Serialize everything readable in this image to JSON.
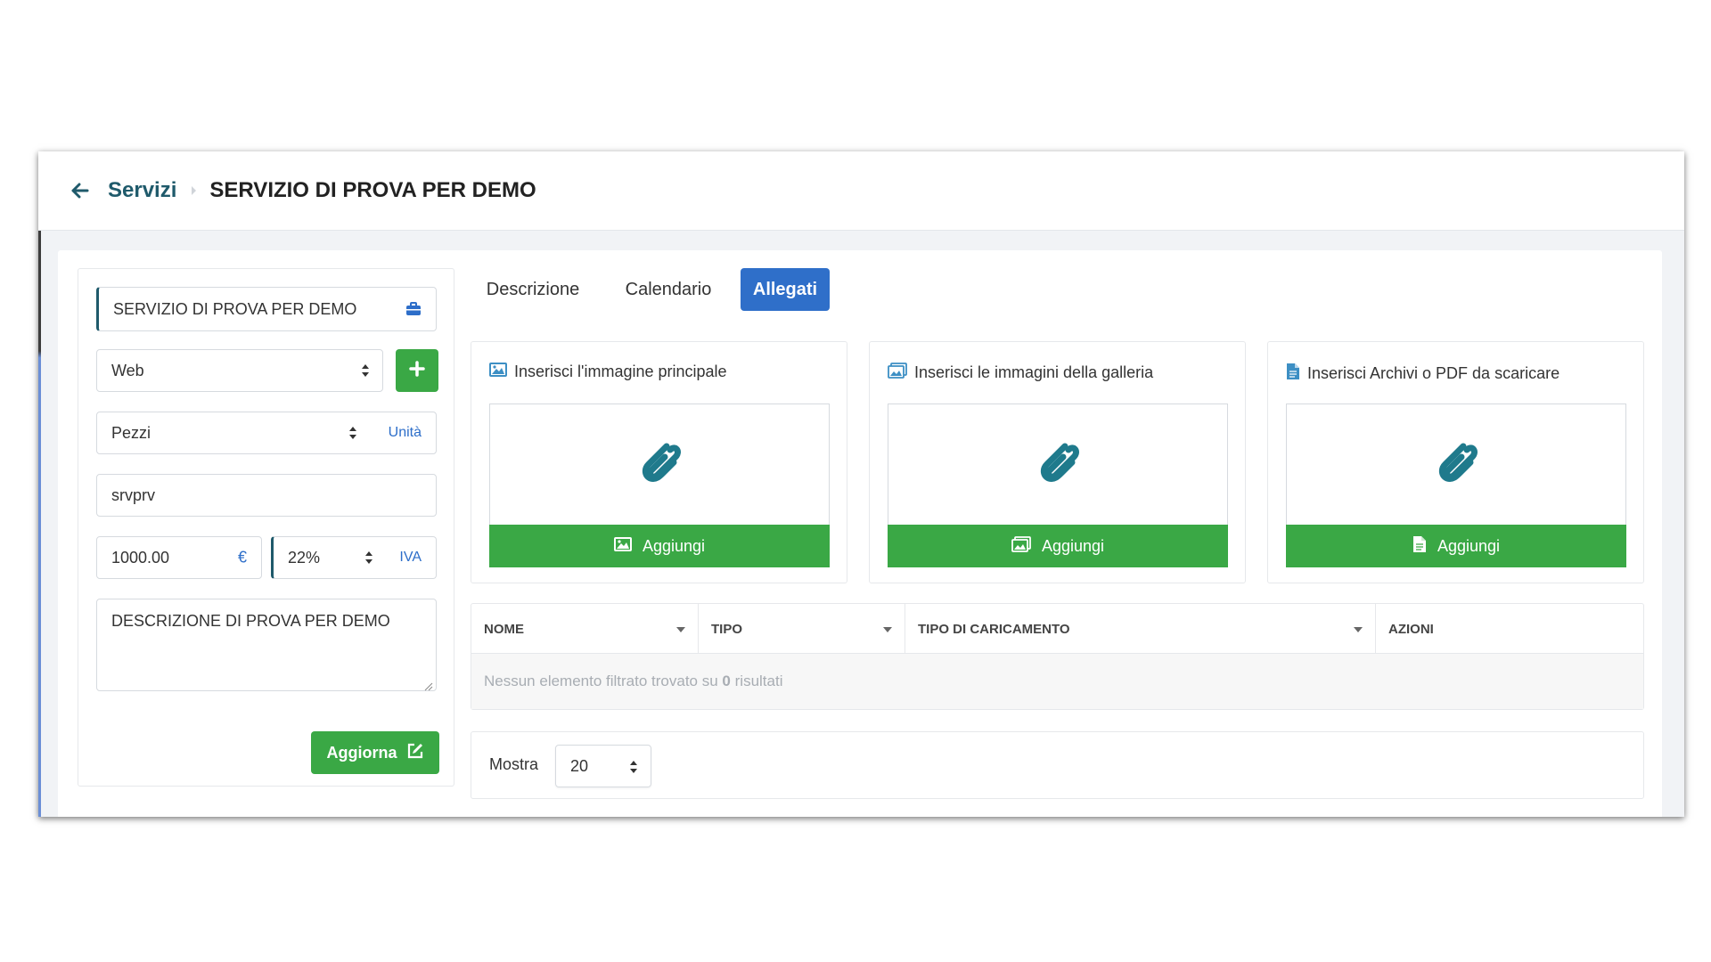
{
  "breadcrumb": {
    "parent": "Servizi",
    "current": "SERVIZIO DI PROVA PER DEMO"
  },
  "form": {
    "name": "SERVIZIO DI PROVA PER DEMO",
    "category": "Web",
    "unit": "Pezzi",
    "unit_suffix": "Unità",
    "code": "srvprv",
    "price": "1000.00",
    "price_suffix": "€",
    "vat": "22%",
    "vat_suffix": "IVA",
    "description": "DESCRIZIONE DI PROVA PER DEMO",
    "update_label": "Aggiorna"
  },
  "tabs": [
    {
      "label": "Descrizione",
      "active": false
    },
    {
      "label": "Calendario",
      "active": false
    },
    {
      "label": "Allegati",
      "active": true
    }
  ],
  "cards": [
    {
      "title": "Inserisci l'immagine principale",
      "icon": "image-icon",
      "button": "Aggiungi"
    },
    {
      "title": "Inserisci le immagini della galleria",
      "icon": "images-icon",
      "button": "Aggiungi"
    },
    {
      "title": "Inserisci Archivi o PDF da scaricare",
      "icon": "file-icon",
      "button": "Aggiungi"
    }
  ],
  "table": {
    "columns": [
      "NOME",
      "TIPO",
      "TIPO DI CARICAMENTO",
      "AZIONI"
    ],
    "empty_prefix": "Nessun elemento filtrato trovato su ",
    "empty_count": "0",
    "empty_suffix": " risultati"
  },
  "pager": {
    "label": "Mostra",
    "page_size": "20"
  },
  "colors": {
    "brand_teal": "#1f5a6b",
    "button_green": "#3aa845",
    "tab_active_blue": "#2f6fc9",
    "paperclip": "#1f7a8c"
  }
}
